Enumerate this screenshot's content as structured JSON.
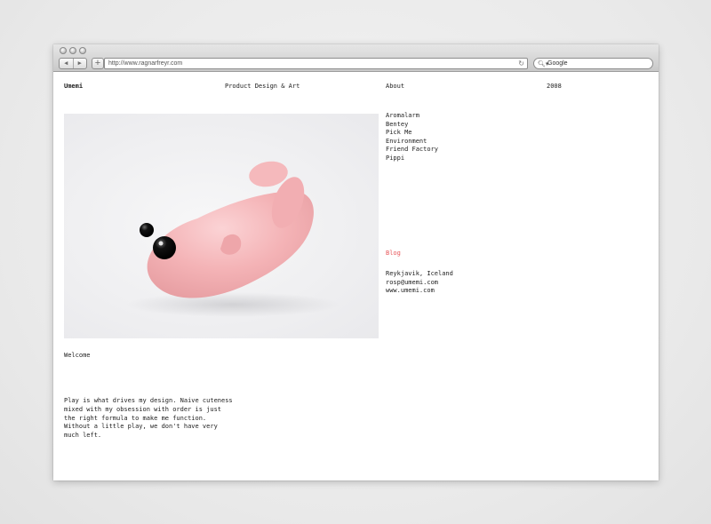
{
  "browser": {
    "url": "http://www.ragnarfreyr.com",
    "search_placeholder": "Google",
    "back_icon": "◀",
    "forward_icon": "▶",
    "add_icon": "+",
    "reload_icon": "↻",
    "search_icon": "🔍︎▾"
  },
  "header": {
    "brand": "Umemi",
    "tagline": "Product Design & Art",
    "about": "About",
    "year": "2008"
  },
  "projects": [
    "Aromalarm",
    "Bentey",
    "Pick Me",
    "Environment",
    "Friend Factory",
    "Pippi"
  ],
  "blog": "Blog",
  "contact": {
    "location": "Reykjavik, Iceland",
    "email": "rosp@umemi.com",
    "website": "www.umemi.com"
  },
  "welcome": "Welcome",
  "intro": "Play is what drives my design. Naive cuteness mixed with my obsession with order is just the right formula to make me function. Without a little play, we don't have very much left.",
  "colors": {
    "accent_link": "#e8565a",
    "toy_pink": "#f4b3b6"
  }
}
